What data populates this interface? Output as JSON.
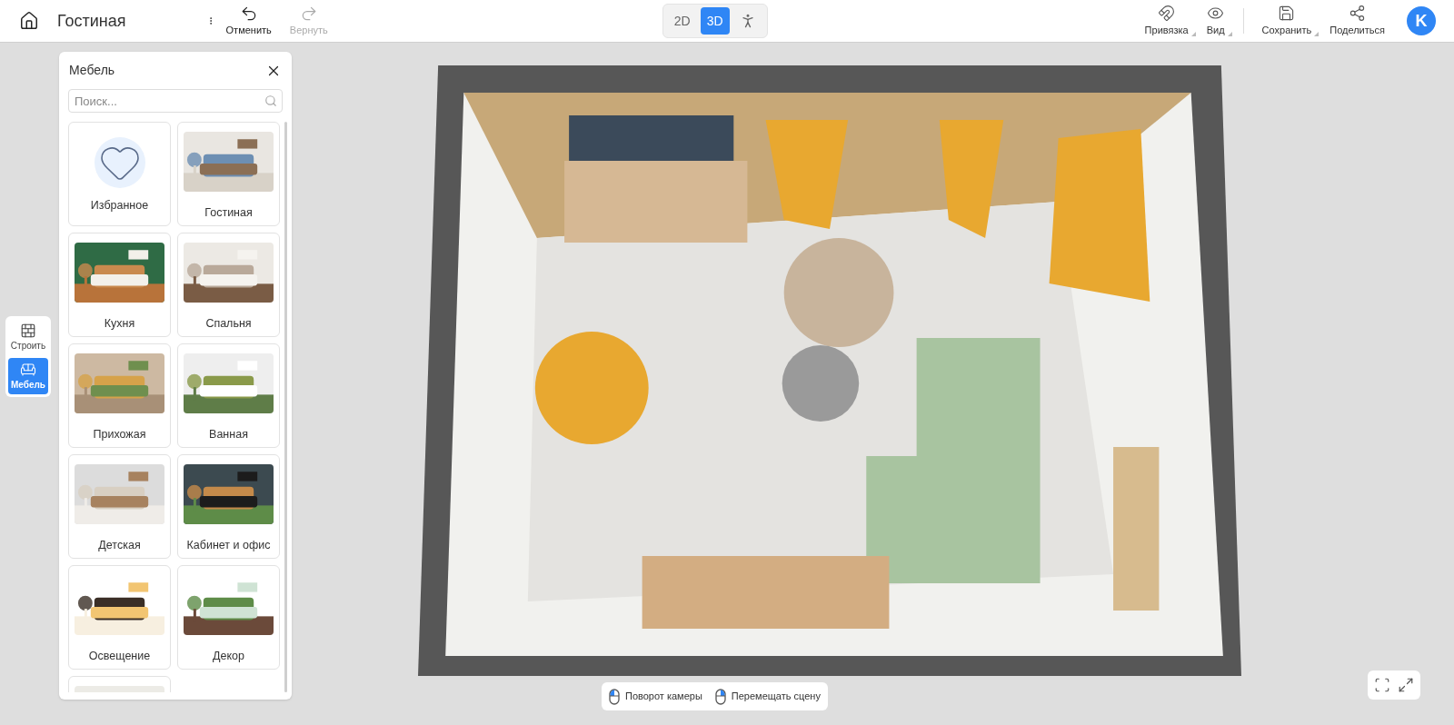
{
  "header": {
    "title": "Гостиная",
    "undo": {
      "label": "Отменить",
      "disabled": false
    },
    "redo": {
      "label": "Вернуть",
      "disabled": true
    },
    "view_modes": [
      {
        "kind": "text",
        "label": "2D",
        "selected": false
      },
      {
        "kind": "text",
        "label": "3D",
        "selected": true
      },
      {
        "kind": "walk",
        "selected": false
      }
    ],
    "tools": [
      {
        "kind": "magnet",
        "label": "Привязка",
        "dropdown": true
      },
      {
        "kind": "eye",
        "label": "Вид",
        "dropdown": true
      },
      {
        "kind": "save",
        "label": "Сохранить",
        "dropdown": true
      },
      {
        "kind": "share",
        "label": "Поделиться",
        "dropdown": false
      }
    ],
    "avatar": "K"
  },
  "side_toolbar": [
    {
      "kind": "build",
      "label": "Строить",
      "selected": false
    },
    {
      "kind": "furniture",
      "label": "Мебель",
      "selected": true
    }
  ],
  "panel": {
    "title": "Мебель",
    "search": {
      "placeholder": "Поиск..."
    },
    "categories": [
      {
        "kind": "favorite",
        "label": "Избранное"
      },
      {
        "kind": "picture",
        "label": "Гостиная"
      },
      {
        "kind": "picture",
        "label": "Кухня"
      },
      {
        "kind": "picture",
        "label": "Спальня"
      },
      {
        "kind": "picture",
        "label": "Прихожая"
      },
      {
        "kind": "picture",
        "label": "Ванная"
      },
      {
        "kind": "picture",
        "label": "Детская"
      },
      {
        "kind": "picture",
        "label": "Кабинет и офис"
      },
      {
        "kind": "picture",
        "label": "Освещение"
      },
      {
        "kind": "picture",
        "label": "Декор"
      },
      {
        "kind": "picture"
      }
    ]
  },
  "hints": [
    {
      "kind": "left",
      "label": "Поворот камеры"
    },
    {
      "kind": "right",
      "label": "Перемещать сцену"
    }
  ]
}
